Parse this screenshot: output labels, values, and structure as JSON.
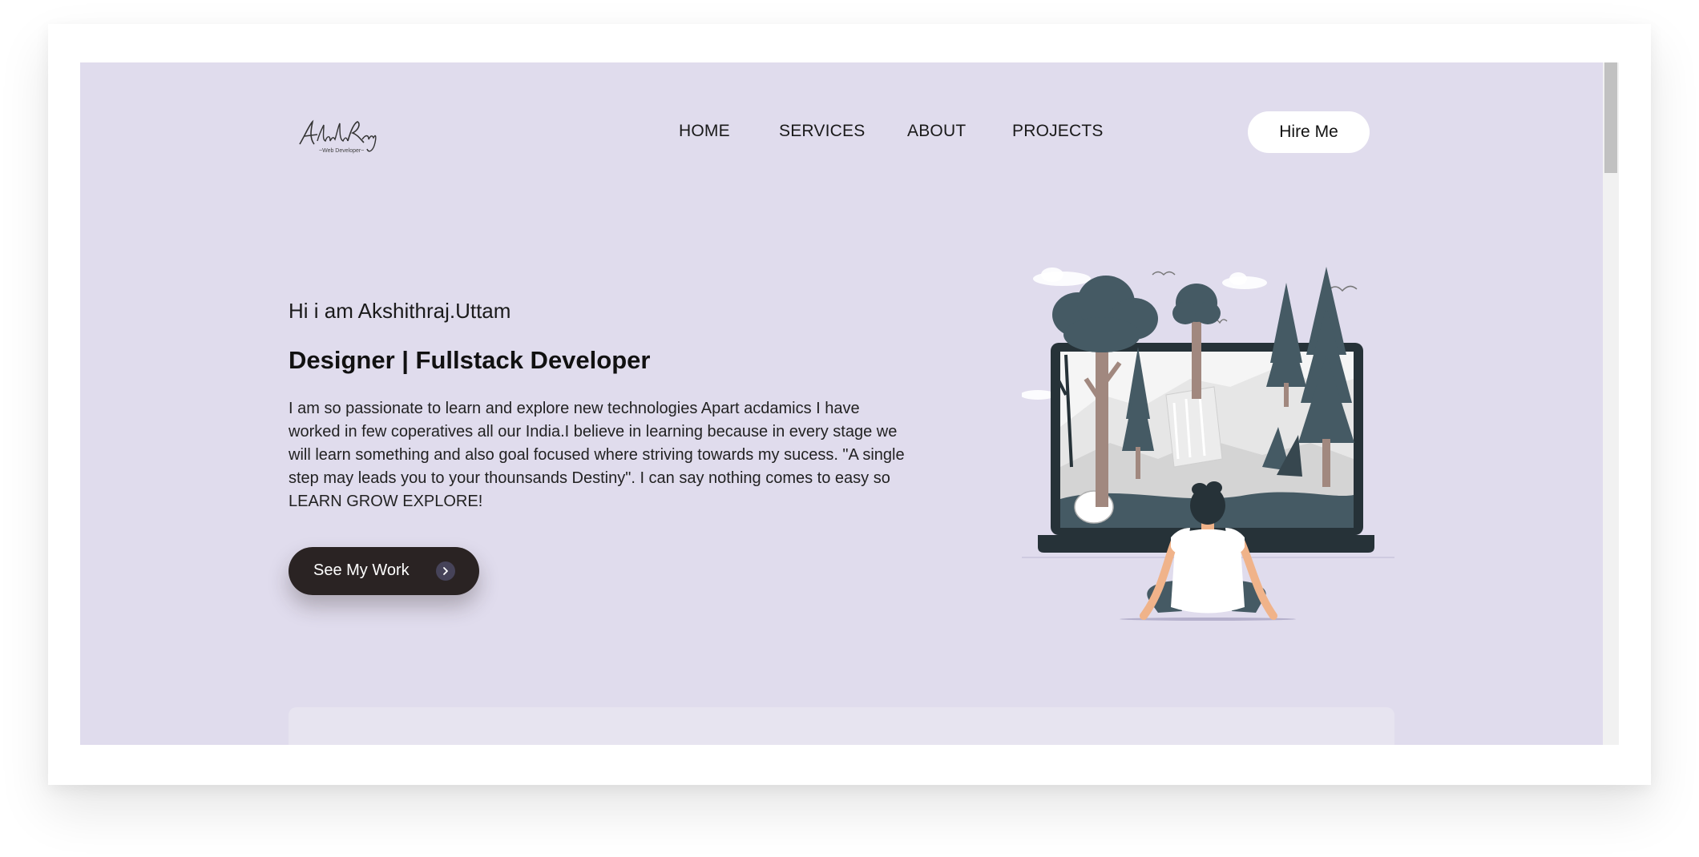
{
  "header": {
    "logo_text": "Akshith Raj",
    "logo_subtext": "~Web Developer~",
    "nav": [
      {
        "label": "HOME"
      },
      {
        "label": "SERVICES"
      },
      {
        "label": "ABOUT"
      },
      {
        "label": "PROJECTS"
      }
    ],
    "hire_label": "Hire Me"
  },
  "hero": {
    "greeting": "Hi i am Akshithraj.Uttam",
    "role": "Designer | Fullstack Developer",
    "bio": "I am so passionate to learn and explore new technologies Apart acdamics I have worked in few coperatives all our India.I believe in learning because in every stage we will learn something and also goal focused where striving towards my sucess. \"A single step may leads you to your thounsands Destiny\". I can say nothing comes to easy so LEARN GROW EXPLORE!",
    "cta_label": "See My Work",
    "cta_icon": "chevron-right-icon"
  },
  "colors": {
    "page_background": "#e0dced",
    "cta_background": "#2a2323",
    "hire_background": "#ffffff",
    "illustration_dark": "#455a64"
  }
}
